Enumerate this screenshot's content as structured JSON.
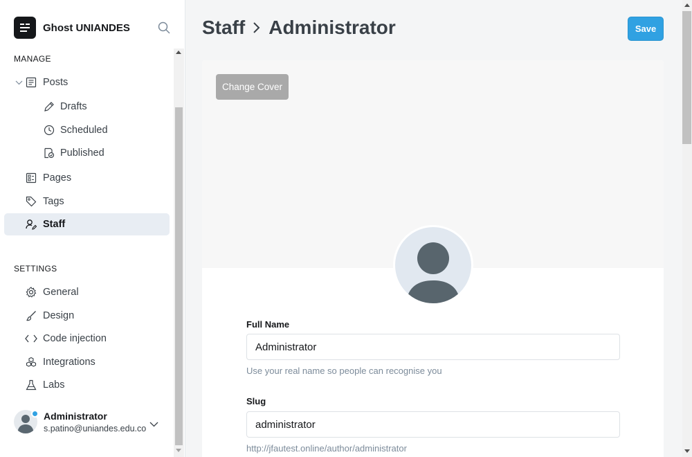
{
  "sidebar": {
    "brand": {
      "name": "Ghost UNIANDES",
      "logo_icon": "ghost-logo-icon"
    },
    "search_icon": "search-icon",
    "manage_title": "MANAGE",
    "settings_title": "SETTINGS",
    "manage_items": [
      {
        "label": "Posts",
        "icon": "posts-icon",
        "expanded": true
      },
      {
        "label": "Drafts",
        "icon": "pencil-icon"
      },
      {
        "label": "Scheduled",
        "icon": "clock-icon"
      },
      {
        "label": "Published",
        "icon": "published-icon"
      },
      {
        "label": "Pages",
        "icon": "pages-icon"
      },
      {
        "label": "Tags",
        "icon": "tag-icon"
      },
      {
        "label": "Staff",
        "icon": "staff-icon",
        "active": true
      }
    ],
    "settings_items": [
      {
        "label": "General",
        "icon": "gear-icon"
      },
      {
        "label": "Design",
        "icon": "brush-icon"
      },
      {
        "label": "Code injection",
        "icon": "code-icon"
      },
      {
        "label": "Integrations",
        "icon": "integrations-icon"
      },
      {
        "label": "Labs",
        "icon": "flask-icon"
      }
    ],
    "user": {
      "name": "Administrator",
      "email": "s.patino@uniandes.edu.co"
    }
  },
  "header": {
    "breadcrumb": [
      "Staff",
      "Administrator"
    ],
    "save_label": "Save"
  },
  "profile": {
    "change_cover_label": "Change Cover",
    "full_name": {
      "label": "Full Name",
      "value": "Administrator",
      "hint": "Use your real name so people can recognise you"
    },
    "slug": {
      "label": "Slug",
      "value": "administrator",
      "hint": "http://jfautest.online/author/administrator"
    }
  },
  "colors": {
    "accent": "#30a1e2",
    "active_bg": "#e8edf3",
    "text": "#15171a",
    "muted": "#7c8b9a"
  }
}
